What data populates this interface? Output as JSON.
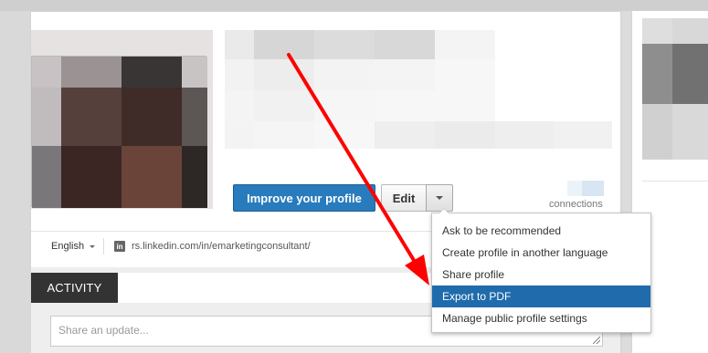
{
  "profile": {
    "improve_button": "Improve your profile",
    "edit_button": "Edit",
    "connections_label": "connections",
    "language": "English",
    "public_url": "rs.linkedin.com/in/emarketingconsultant/"
  },
  "edit_menu": {
    "items": [
      {
        "label": "Ask to be recommended"
      },
      {
        "label": "Create profile in another language"
      },
      {
        "label": "Share profile"
      },
      {
        "label": "Export to PDF"
      },
      {
        "label": "Manage public profile settings"
      }
    ],
    "selected": "Export to PDF"
  },
  "activity": {
    "tab_label": "ACTIVITY",
    "share_placeholder": "Share an update..."
  },
  "icons": {
    "linkedin": "linkedin-icon",
    "caret": "chevron-down-icon",
    "annotation": "red-arrow-annotation"
  },
  "colors": {
    "primary_button": "#287bbc",
    "menu_highlight": "#1f6bab",
    "activity_tab": "#333333",
    "annotation_arrow": "#ff0000"
  }
}
